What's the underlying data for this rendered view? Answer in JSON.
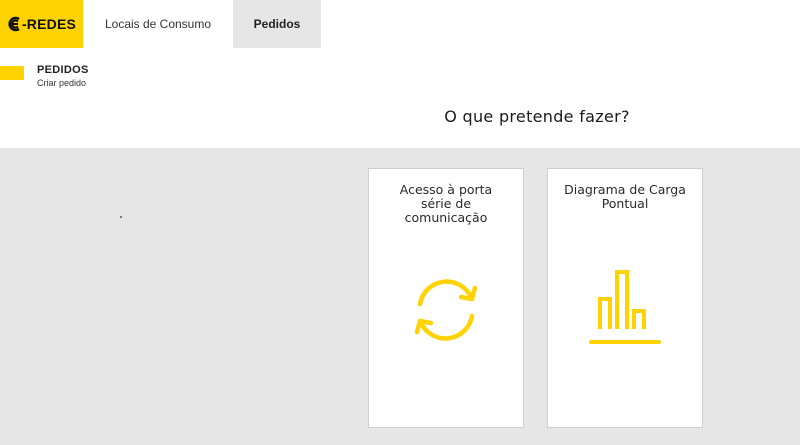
{
  "header": {
    "logo_text": "-REDES",
    "nav": [
      {
        "label": "Locais de Consumo"
      },
      {
        "label": "Pedidos"
      }
    ]
  },
  "breadcrumb": {
    "title": "PEDIDOS",
    "subtitle": "Criar pedido"
  },
  "main": {
    "question": "O que pretende fazer?",
    "cards": [
      {
        "title": "Acesso à porta série de comunicação",
        "icon": "refresh-icon"
      },
      {
        "title": "Diagrama de Carga Pontual",
        "icon": "bar-chart-icon"
      }
    ]
  },
  "colors": {
    "accent": "#ffd200",
    "background_grey": "#e6e6e6",
    "card_bg": "#ffffff",
    "text": "#222222"
  }
}
